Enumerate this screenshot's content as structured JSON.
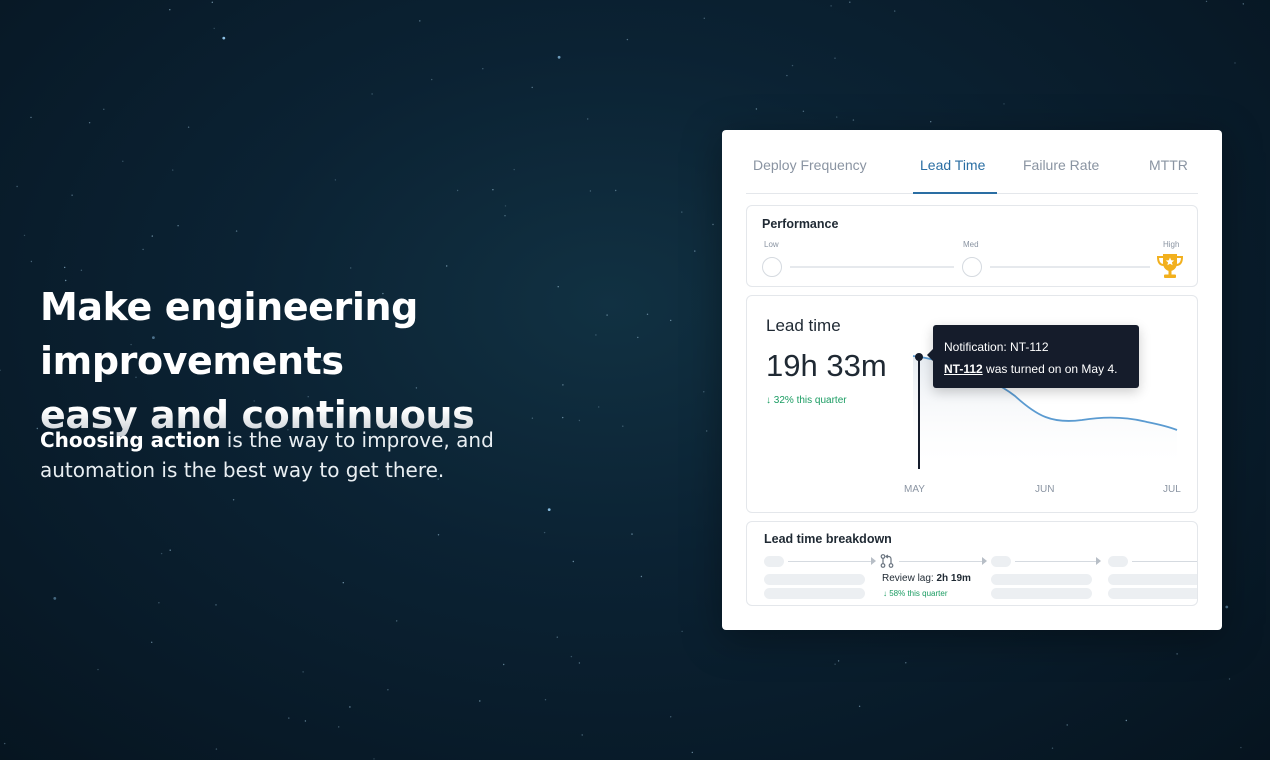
{
  "hero": {
    "title_line1": "Make engineering improvements",
    "title_line2": "easy and continuous",
    "subtitle_bold": "Choosing action",
    "subtitle_rest": " is the way to improve, and automation is the best way to get there."
  },
  "tabs": [
    {
      "label": "Deploy Frequency",
      "active": false
    },
    {
      "label": "Lead Time",
      "active": true
    },
    {
      "label": "Failure Rate",
      "active": false
    },
    {
      "label": "MTTR",
      "active": false
    }
  ],
  "performance": {
    "title": "Performance",
    "levels": [
      "Low",
      "Med",
      "High"
    ],
    "current_level": "High",
    "icon": "trophy-icon"
  },
  "lead_time": {
    "title": "Lead time",
    "value": "19h 33m",
    "delta": "↓ 32% this quarter",
    "months": [
      "MAY",
      "JUN",
      "JUL"
    ],
    "tooltip": {
      "title": "Notification: NT-112",
      "link": "NT-112",
      "text": " was turned on on May 4."
    }
  },
  "breakdown": {
    "title": "Lead time breakdown",
    "review_lag_label": "Review lag: ",
    "review_lag_value": "2h 19m",
    "delta": "↓ 58% this quarter",
    "icon": "pull-request-icon"
  },
  "colors": {
    "accent": "#2a6ea3",
    "positive": "#1a9c62",
    "trophy": "#f2b01e",
    "line": "#5b9bd1",
    "tooltip_bg": "#151c2b"
  }
}
